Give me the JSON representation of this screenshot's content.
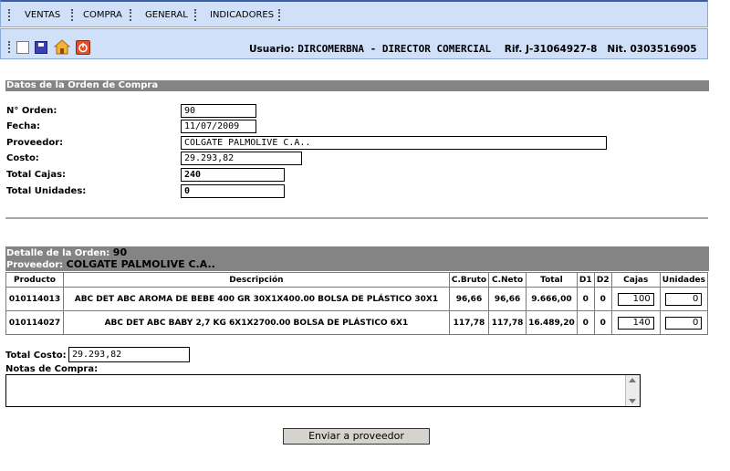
{
  "menu": {
    "items": [
      "VENTAS",
      "COMPRA",
      "GENERAL",
      "INDICADORES"
    ]
  },
  "toolbar": {
    "icons": [
      "new-document-icon",
      "save-disk-icon",
      "home-icon",
      "power-off-icon"
    ],
    "user_label": "Usuario:",
    "user_value": "DIRCOMERBNA - DIRECTOR COMERCIAL",
    "rif_label": "Rif.",
    "rif_value": "J-31064927-8",
    "nit_label": "Nit.",
    "nit_value": "0303516905"
  },
  "order": {
    "section_title": "Datos de la Orden de Compra",
    "numero_label": "N° Orden:",
    "numero": "90",
    "fecha_label": "Fecha:",
    "fecha": "11/07/2009",
    "proveedor_label": "Proveedor:",
    "proveedor": "COLGATE PALMOLIVE C.A..",
    "costo_label": "Costo:",
    "costo": "29.293,82",
    "cajas_label": "Total Cajas:",
    "cajas": "240",
    "unidades_label": "Total Unidades:",
    "unidades": "0"
  },
  "detail": {
    "title_label": "Detalle de la Orden:",
    "title_value": "90",
    "provider_label": "Proveedor:",
    "provider_value": "COLGATE PALMOLIVE C.A..",
    "columns": [
      "Producto",
      "Descripción",
      "C.Bruto",
      "C.Neto",
      "Total",
      "D1",
      "D2",
      "Cajas",
      "Unidades"
    ],
    "rows": [
      {
        "producto": "010114013",
        "descripcion": "ABC DET ABC AROMA DE BEBE 400 GR 30X1X400.00 BOLSA DE PLÁSTICO 30X1",
        "cbruto": "96,66",
        "cneto": "96,66",
        "total": "9.666,00",
        "d1": "0",
        "d2": "0",
        "cajas": "100",
        "unidades": "0"
      },
      {
        "producto": "010114027",
        "descripcion": "ABC DET ABC BABY 2,7 KG 6X1X2700.00 BOLSA DE PLÁSTICO 6X1",
        "cbruto": "117,78",
        "cneto": "117,78",
        "total": "16.489,20",
        "d1": "0",
        "d2": "0",
        "cajas": "140",
        "unidades": "0"
      }
    ]
  },
  "footer": {
    "total_costo_label": "Total Costo:",
    "total_costo": "29.293,82",
    "notas_label": "Notas de Compra:",
    "notas_value": "",
    "send_button": "Enviar a proveedor"
  },
  "colors": {
    "menu_bg": "#cfe0f8",
    "menu_border": "#3a5fa8",
    "section_header": "#848484"
  }
}
